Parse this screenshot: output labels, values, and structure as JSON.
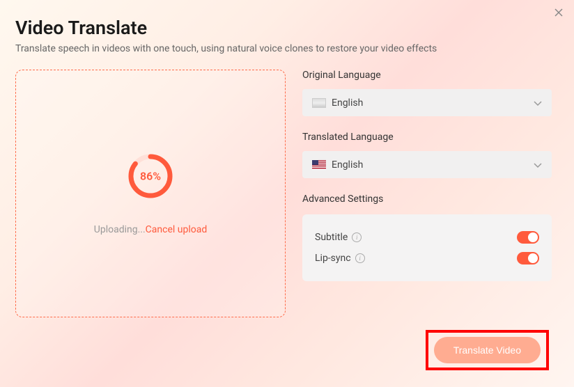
{
  "title": "Video Translate",
  "subtitle": "Translate speech in videos with one touch, using natural voice clones to restore your video effects",
  "upload": {
    "progress_percent": "86%",
    "progress_value": 86,
    "status_text": "Uploading...",
    "cancel_text": "Cancel upload"
  },
  "settings": {
    "original_label": "Original Language",
    "original_value": "English",
    "translated_label": "Translated Language",
    "translated_value": "English",
    "advanced_label": "Advanced Settings",
    "subtitle_label": "Subtitle",
    "subtitle_on": true,
    "lipsync_label": "Lip-sync",
    "lipsync_on": true
  },
  "cta": {
    "translate_button": "Translate Video"
  }
}
